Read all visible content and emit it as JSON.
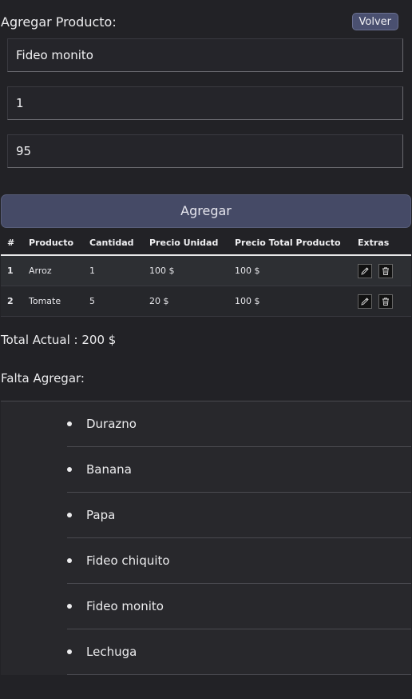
{
  "header": {
    "title": "Agregar Producto:",
    "back_label": "Volver"
  },
  "form": {
    "product_value": "Fideo monito",
    "quantity_value": "1",
    "price_value": "95",
    "add_label": "Agregar"
  },
  "table": {
    "headers": [
      "#",
      "Producto",
      "Cantidad",
      "Precio Unidad",
      "Precio Total Producto",
      "Extras"
    ],
    "rows": [
      {
        "index": "1",
        "product": "Arroz",
        "quantity": "1",
        "unit_price": "100 $",
        "total_price": "100 $"
      },
      {
        "index": "2",
        "product": "Tomate",
        "quantity": "5",
        "unit_price": "20 $",
        "total_price": "100 $"
      }
    ],
    "icons": [
      "pencil-icon",
      "trash-icon"
    ]
  },
  "summary": {
    "total": "Total Actual : 200 $"
  },
  "missing": {
    "title": "Falta Agregar:",
    "items": [
      "Durazno",
      "Banana",
      "Papa",
      "Fideo chiquito",
      "Fideo monito",
      "Lechuga"
    ]
  },
  "colors": {
    "background": "#222226",
    "accent": "#454a66",
    "text": "#ececee"
  }
}
